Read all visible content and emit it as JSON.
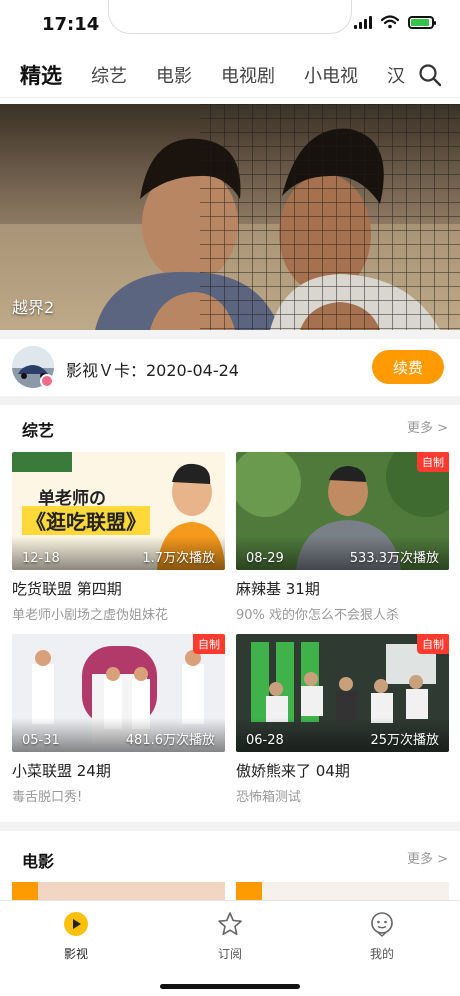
{
  "status_bar": {
    "time": "17:14"
  },
  "nav": {
    "tabs": [
      {
        "label": "精选",
        "active": true
      },
      {
        "label": "综艺"
      },
      {
        "label": "电影"
      },
      {
        "label": "电视剧"
      },
      {
        "label": "小电视"
      },
      {
        "label": "汉"
      }
    ]
  },
  "banner": {
    "title": "越界2"
  },
  "vip": {
    "text": "影视Ｖ卡：2020-04-24",
    "button_label": "续费"
  },
  "variety": {
    "title": "综艺",
    "more": "更多 >",
    "cards": [
      {
        "title": "吃货联盟 第四期",
        "subtitle": "单老师小剧场之虚伪姐妹花",
        "date": "12-18",
        "plays": "1.7万次播放",
        "badge": "",
        "overlay_line1": "单老师の",
        "overlay_line2": "《逛吃联盟》"
      },
      {
        "title": "麻辣基 31期",
        "subtitle": "90% 戏的你怎么不会狠人杀",
        "date": "08-29",
        "plays": "533.3万次播放",
        "badge": "自制"
      },
      {
        "title": "小菜联盟 24期",
        "subtitle": "毒舌脱口秀!",
        "date": "05-31",
        "plays": "481.6万次播放",
        "badge": "自制"
      },
      {
        "title": "傲娇熊来了 04期",
        "subtitle": "恐怖箱测试",
        "date": "06-28",
        "plays": "25万次播放",
        "badge": "自制"
      }
    ]
  },
  "movies": {
    "title": "电影",
    "more": "更多 >"
  },
  "tab_bar": {
    "items": [
      {
        "label": "影视",
        "active": true
      },
      {
        "label": "订阅"
      },
      {
        "label": "我的"
      }
    ]
  },
  "colors": {
    "accent": "#ff9b00",
    "badge_red": "#ff3b30",
    "tab_active": "#ffc107"
  }
}
